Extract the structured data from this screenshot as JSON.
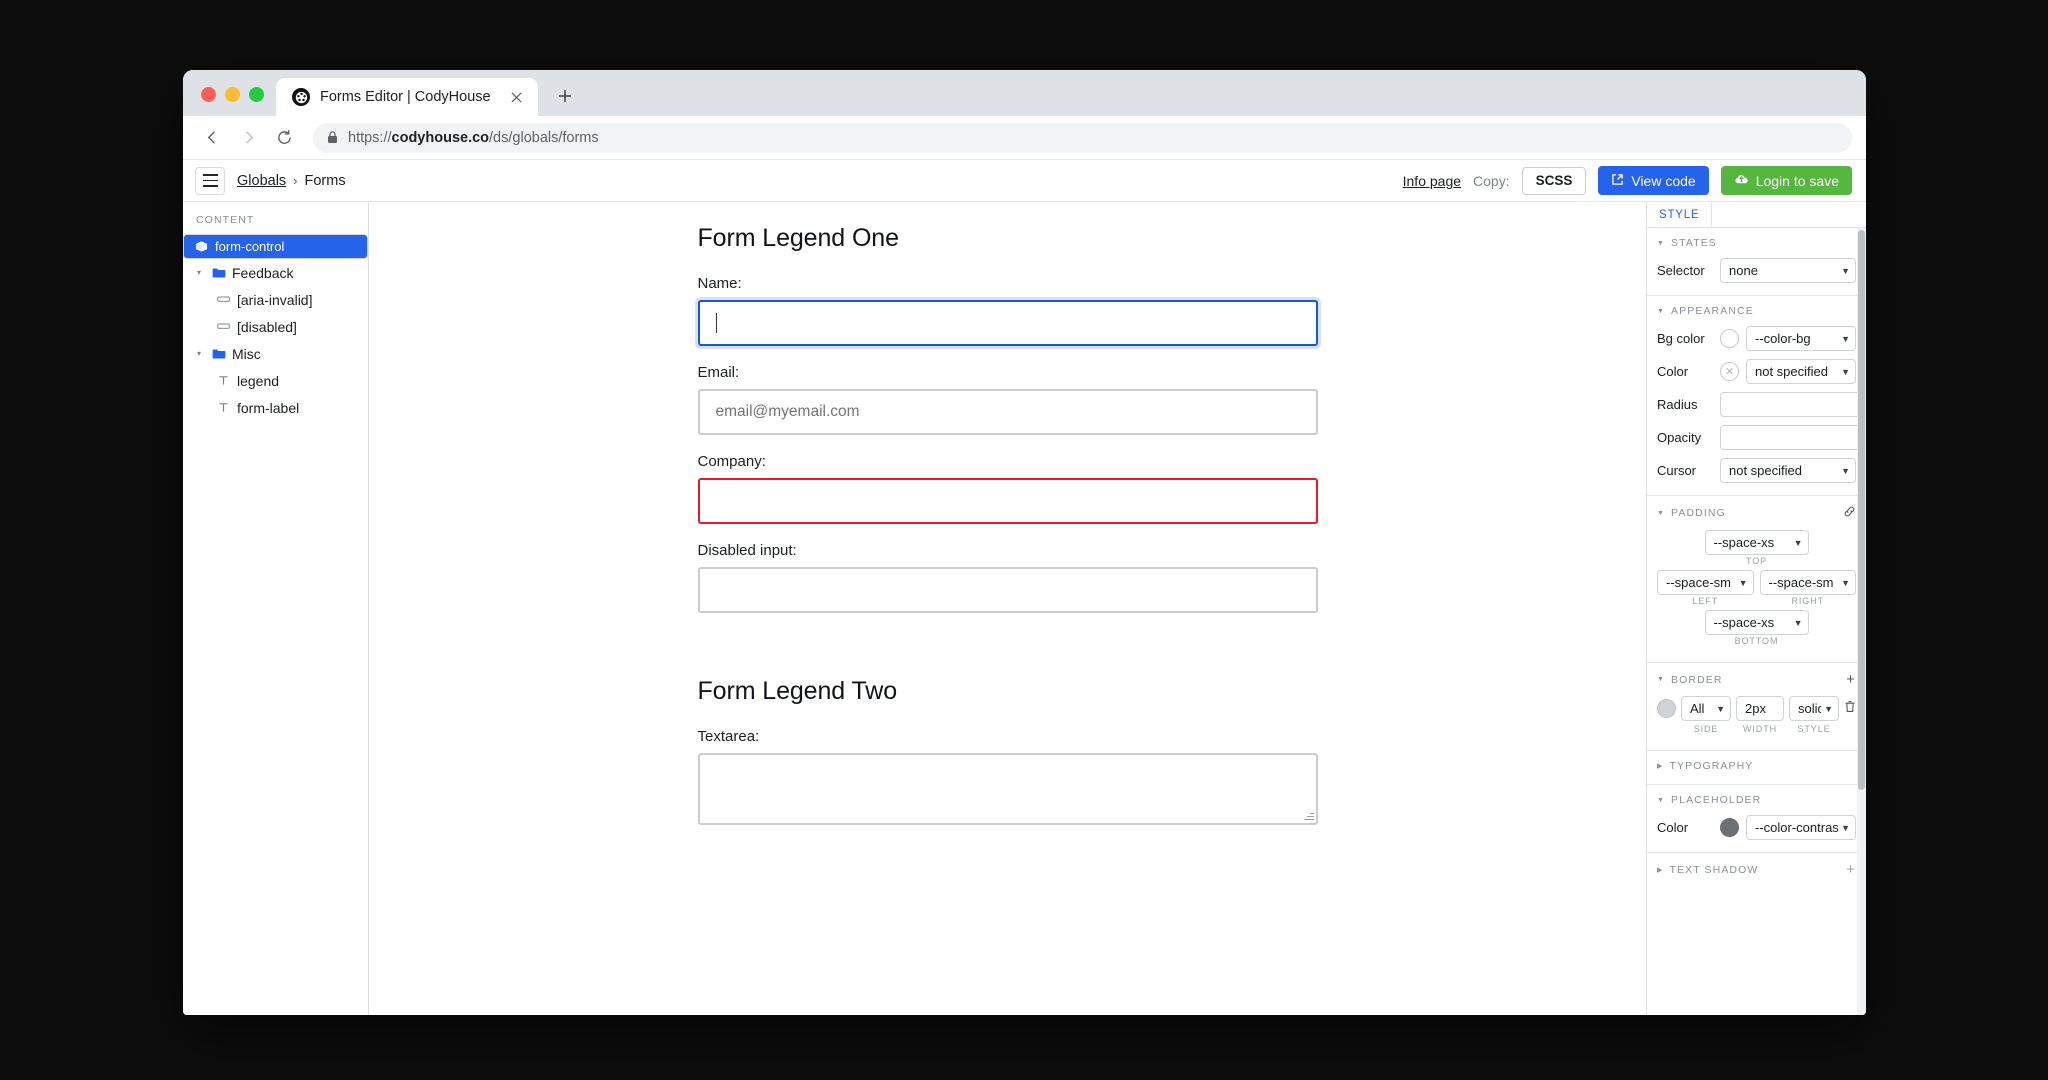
{
  "browser": {
    "tab": {
      "title": "Forms Editor | CodyHouse",
      "favicon": "codyhouse-logo-icon",
      "close": "×"
    },
    "new_tab": "+",
    "nav": {
      "back": "←",
      "forward": "→",
      "reload": "⟳"
    },
    "url": {
      "secure_icon": "lock-icon",
      "scheme": "https://",
      "host": "codyhouse.co",
      "path": "/ds/globals/forms"
    }
  },
  "toolbar": {
    "menu": "hamburger-menu",
    "breadcrumb": {
      "root": "Globals",
      "separator": "›",
      "current": "Forms"
    },
    "info_page": "Info page",
    "copy_label": "Copy:",
    "format": "SCSS",
    "view_code": "View code",
    "login_save": "Login to save"
  },
  "sidebar": {
    "heading": "CONTENT",
    "items": [
      {
        "label": "form-control",
        "icon": "package-icon",
        "depth": 0,
        "selected": true,
        "twisty": ""
      },
      {
        "label": "Feedback",
        "icon": "folder-icon",
        "depth": 1,
        "selected": false,
        "twisty": "▾"
      },
      {
        "label": "[aria-invalid]",
        "icon": "chip-icon",
        "depth": 2,
        "selected": false,
        "twisty": ""
      },
      {
        "label": "[disabled]",
        "icon": "chip-icon",
        "depth": 2,
        "selected": false,
        "twisty": ""
      },
      {
        "label": "Misc",
        "icon": "folder-icon",
        "depth": 1,
        "selected": false,
        "twisty": "▾"
      },
      {
        "label": "legend",
        "icon": "text-icon",
        "depth": 2,
        "selected": false,
        "twisty": ""
      },
      {
        "label": "form-label",
        "icon": "text-icon",
        "depth": 2,
        "selected": false,
        "twisty": ""
      }
    ]
  },
  "form": {
    "legend_one": "Form Legend One",
    "legend_two": "Form Legend Two",
    "fields": [
      {
        "label": "Name:",
        "value": "",
        "placeholder": "",
        "state": "focus"
      },
      {
        "label": "Email:",
        "value": "",
        "placeholder": "email@myemail.com",
        "state": "normal"
      },
      {
        "label": "Company:",
        "value": "",
        "placeholder": "",
        "state": "invalid"
      },
      {
        "label": "Disabled input:",
        "value": "",
        "placeholder": "",
        "state": "disabled"
      }
    ],
    "textarea": {
      "label": "Textarea:",
      "value": ""
    }
  },
  "panel": {
    "tab": "STYLE",
    "states": {
      "title": "STATES",
      "selector_label": "Selector",
      "selector_value": "none"
    },
    "appearance": {
      "title": "APPEARANCE",
      "bg_color_label": "Bg color",
      "bg_color_value": "--color-bg",
      "color_label": "Color",
      "color_value": "not specified",
      "radius_label": "Radius",
      "radius_value": "",
      "opacity_label": "Opacity",
      "opacity_value": "",
      "cursor_label": "Cursor",
      "cursor_value": "not specified"
    },
    "padding": {
      "title": "PADDING",
      "link_icon": "link-icon",
      "top": {
        "value": "--space-xs",
        "label": "TOP"
      },
      "left": {
        "value": "--space-sm",
        "label": "LEFT"
      },
      "right": {
        "value": "--space-sm",
        "label": "RIGHT"
      },
      "bottom": {
        "value": "--space-xs",
        "label": "BOTTOM"
      }
    },
    "border": {
      "title": "BORDER",
      "add": "+",
      "side": {
        "value": "All",
        "label": "SIDE"
      },
      "width": {
        "value": "2px",
        "label": "WIDTH"
      },
      "style": {
        "value": "solid",
        "label": "STYLE"
      },
      "delete_icon": "trash-icon"
    },
    "typography": {
      "title": "TYPOGRAPHY"
    },
    "placeholder": {
      "title": "PLACEHOLDER",
      "color_label": "Color",
      "color_value": "--color-contrast-n"
    },
    "text_shadow": {
      "title": "TEXT SHADOW",
      "add": "+"
    }
  },
  "colors": {
    "accent_blue": "#2563eb",
    "green": "#56b63f",
    "invalid_red": "#e8192c",
    "focus_blue": "#1a56db"
  }
}
